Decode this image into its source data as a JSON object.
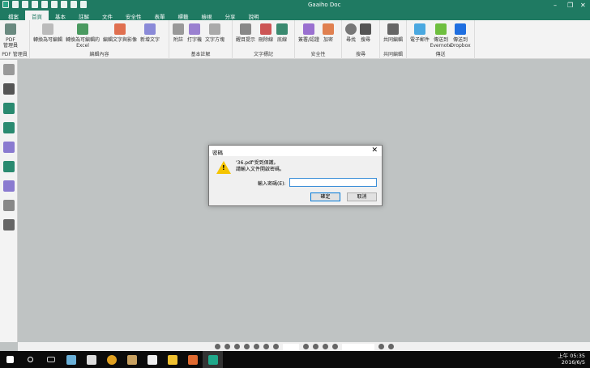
{
  "app": {
    "title": "Gaaiho Doc"
  },
  "tabs": [
    "檔案",
    "首頁",
    "基本",
    "註解",
    "文件",
    "安全性",
    "表單",
    "標籤",
    "檢視",
    "分享",
    "說明"
  ],
  "active_tab": "首頁",
  "ribbon": [
    {
      "group": "PDF 管理員",
      "buttons": [
        "PDF\n管理員"
      ]
    },
    {
      "group": "編輯內容",
      "buttons": [
        "轉換為可編輯",
        "轉換為可編輯的 Excel",
        "編輯文字與影像",
        "新增文字"
      ]
    },
    {
      "group": "基本註解",
      "buttons": [
        "附註",
        "打字機",
        "文字方塊"
      ]
    },
    {
      "group": "文字標記",
      "buttons": [
        "醒目提示",
        "刪除線",
        "底線"
      ]
    },
    {
      "group": "安全性",
      "buttons": [
        "簽署/認證",
        "加密"
      ]
    },
    {
      "group": "搜尋",
      "buttons": [
        "尋找",
        "搜尋"
      ]
    },
    {
      "group": "共同編輯",
      "buttons": [
        "共同編輯"
      ]
    },
    {
      "group": "傳送",
      "buttons": [
        "電子郵件",
        "傳送到 Evernote",
        "傳送到 Dropbox"
      ]
    }
  ],
  "dialog": {
    "title": "密碼",
    "message_line1": "'36.pdf'受到保護。",
    "message_line2": "請輸入文件開啟密碼。",
    "password_label": "輸入密碼(E):",
    "password_value": "",
    "ok": "確定",
    "cancel": "取消"
  },
  "clock": {
    "time": "上午 05:35",
    "date": "2016/6/5"
  },
  "colors": {
    "brand": "#1f7a62",
    "warning": "#f5c400"
  }
}
